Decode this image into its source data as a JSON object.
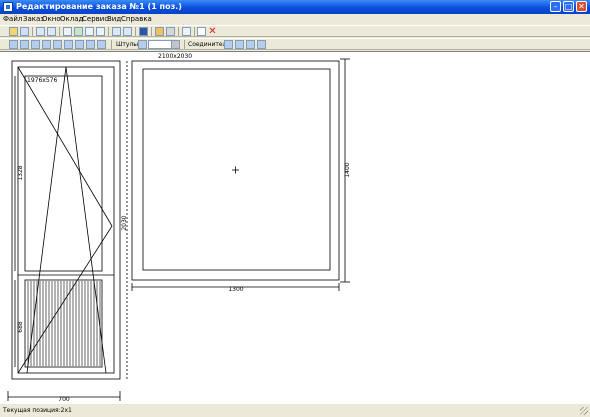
{
  "window": {
    "title": "Редактирование заказа №1 (1 поз.)",
    "controls": {
      "minimize": "–",
      "maximize": "□",
      "close": "✕"
    }
  },
  "menu": [
    "Файл",
    "Заказ",
    "Окно",
    "Оклад",
    "Сервис",
    "Вид",
    "Справка"
  ],
  "toolbar": {
    "shtulp_label": "Штульп:",
    "connector_label": "Соединитель:"
  },
  "drawing": {
    "door": {
      "leaf_size_label": "1976х576",
      "dim_upper": "1328",
      "dim_lower": "688",
      "dim_height": "2030",
      "dim_width": "700"
    },
    "window": {
      "size_label": "2100х2030",
      "dim_width": "1300",
      "dim_height": "1400"
    }
  },
  "status": {
    "text": "Текущая позиция:2х1"
  },
  "colors": {
    "title_bar": "#0a4ede",
    "chrome": "#ece9d8",
    "canvas": "#ffffff",
    "close_button": "#d8502f"
  }
}
